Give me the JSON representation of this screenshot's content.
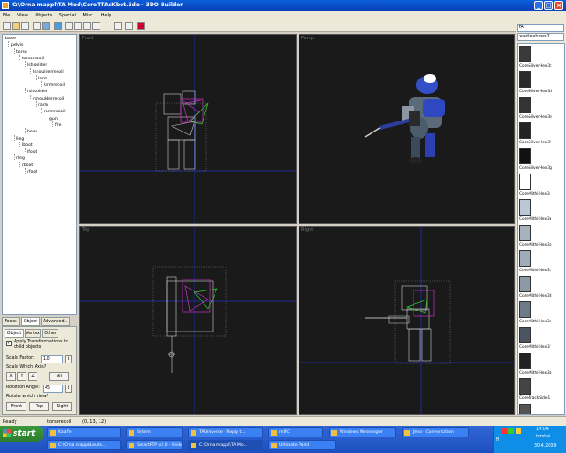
{
  "window": {
    "title": "C:\\Orna mappl\\TA Mod\\CoreTTAsKbot.3do - 3DO Builder",
    "controls": [
      "_",
      "□",
      "×"
    ]
  },
  "menu": [
    "File",
    "View",
    "Objects",
    "Special",
    "Misc.",
    "Help"
  ],
  "tree": [
    {
      "label": "base",
      "depth": 0
    },
    {
      "label": "pelvis",
      "depth": 1
    },
    {
      "label": "torso",
      "depth": 2
    },
    {
      "label": "torsorecoil",
      "depth": 3
    },
    {
      "label": "lshoulder",
      "depth": 4
    },
    {
      "label": "lshoulderrecoil",
      "depth": 5
    },
    {
      "label": "larm",
      "depth": 6
    },
    {
      "label": "larmrecoil",
      "depth": 7
    },
    {
      "label": "rshoulder",
      "depth": 4
    },
    {
      "label": "rshoulderrecoil",
      "depth": 5
    },
    {
      "label": "rarm",
      "depth": 6
    },
    {
      "label": "rarmrecoil",
      "depth": 7
    },
    {
      "label": "gun",
      "depth": 8
    },
    {
      "label": "fire",
      "depth": 9
    },
    {
      "label": "head",
      "depth": 4
    },
    {
      "label": "lleg",
      "depth": 2
    },
    {
      "label": "lboot",
      "depth": 3
    },
    {
      "label": "lfoot",
      "depth": 4
    },
    {
      "label": "rleg",
      "depth": 2
    },
    {
      "label": "rboot",
      "depth": 3
    },
    {
      "label": "rfoot",
      "depth": 4
    }
  ],
  "left_tabs": [
    "Faces",
    "Object",
    "Advanced..."
  ],
  "sub_tabs": [
    "Object",
    "Vertex",
    "Other"
  ],
  "props": {
    "apply_transform": "Apply Transformations to child objects",
    "scale_factor_label": "Scale Factor:",
    "scale_factor_value": "1.0",
    "scale_axis_label": "Scale Which Axis?",
    "axes": [
      "X",
      "Y",
      "Z",
      "All"
    ],
    "rotation_label": "Rotation Angle:",
    "rotation_value": "45",
    "rotate_view_label": "Rotate which view?",
    "views": [
      "Front",
      "Top",
      "Right"
    ]
  },
  "viewports": [
    "Front",
    "Persp",
    "Top",
    "Right"
  ],
  "right_panel": {
    "combo1": "TA",
    "combo2": "readtextures2",
    "textures": [
      {
        "name": "CoreSilverHex3c",
        "color": "#3a3a3a"
      },
      {
        "name": "CoreSilverHex3d",
        "color": "#2a2a2a"
      },
      {
        "name": "CoreSilverHex3e",
        "color": "#333333"
      },
      {
        "name": "CoreSilverHex3f",
        "color": "#222222"
      },
      {
        "name": "CoreSilverHex3g",
        "color": "#111111"
      },
      {
        "name": "CoreMithilHex3",
        "color": "#ffffff"
      },
      {
        "name": "CoreMithilHex3a",
        "color": "#b9c8d4"
      },
      {
        "name": "CoreMithilHex3b",
        "color": "#a6b3bd"
      },
      {
        "name": "CoreMithilHex3c",
        "color": "#9fadb8"
      },
      {
        "name": "CoreMithilHex3d",
        "color": "#8b9aa5"
      },
      {
        "name": "CoreMithilHex3e",
        "color": "#6d7b86"
      },
      {
        "name": "CoreMithilHex3f",
        "color": "#4a5560"
      },
      {
        "name": "CoreMithilHex3g",
        "color": "#222222"
      },
      {
        "name": "CoreTrackSide1",
        "color": "#444444"
      },
      {
        "name": "CoreTrackSide1b",
        "color": "#555555"
      }
    ]
  },
  "status": {
    "ready": "Ready",
    "object": "torsorecoil",
    "coords": "(0, 13, 12)"
  },
  "taskbar": {
    "start": "start",
    "tasks_row1": [
      "Kaaffe",
      "Sytem",
      "TAUniverse - Reply t...",
      "mIRC",
      "Windows Messenger",
      "Jimo - Conversation"
    ],
    "tasks_row2": [
      "C:\\Orna mappl\\Leuta...",
      "SmartFTP v2.0 - Uniko...",
      "C:\\Orna mappl\\TA Mo...",
      "Ultimate Paint"
    ],
    "lang": "FI",
    "time": "19:04",
    "day": "torstai",
    "date": "30.4.2009"
  },
  "colors": {
    "titlebar": "#0a5fd9",
    "viewport_bg": "#1a1a1a",
    "axis_line": "#1e2b9a",
    "wire_model": "#cfcfcf",
    "wire_selected": "#cc33cc",
    "wire_green": "#33cc33",
    "taskbar": "#245edb"
  }
}
